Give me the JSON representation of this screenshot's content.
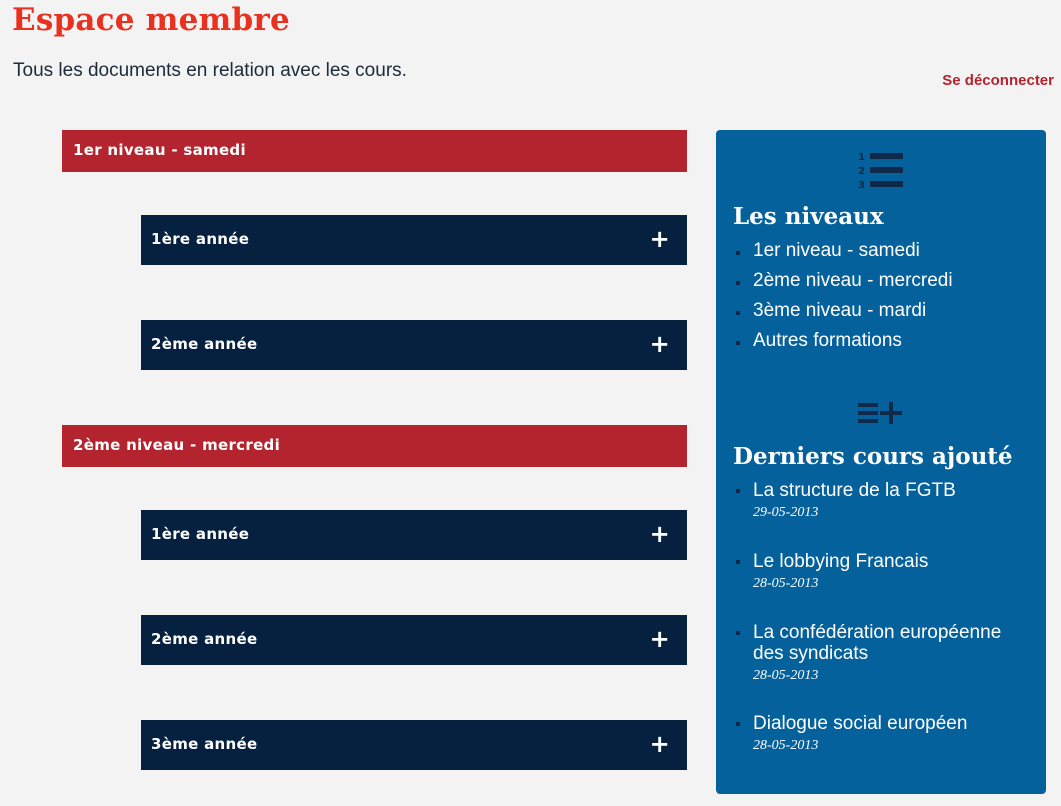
{
  "header": {
    "title": "Espace membre",
    "subtitle": "Tous les documents en relation avec les cours.",
    "logout": "Se déconnecter"
  },
  "levels": [
    {
      "label": "1er niveau - samedi",
      "years": [
        {
          "label": "1ère année",
          "toggle": "+"
        },
        {
          "label": "2ème année",
          "toggle": "+"
        }
      ]
    },
    {
      "label": "2ème niveau - mercredi",
      "years": [
        {
          "label": "1ère année",
          "toggle": "+"
        },
        {
          "label": "2ème année",
          "toggle": "+"
        },
        {
          "label": "3ème année",
          "toggle": "+"
        }
      ]
    }
  ],
  "sidebar": {
    "levels_icon": "numbered-list-icon",
    "levels_heading": "Les niveaux",
    "levels": [
      "1er niveau - samedi",
      "2ème niveau - mercredi",
      "3ème niveau - mardi",
      "Autres formations"
    ],
    "recent_icon": "list-add-icon",
    "recent_heading": "Derniers cours ajouté",
    "recent": [
      {
        "title": "La structure de la FGTB",
        "date": "29-05-2013"
      },
      {
        "title": "Le lobbying Francais",
        "date": "28-05-2013"
      },
      {
        "title": "La confédération européenne des syndicats",
        "date": "28-05-2013"
      },
      {
        "title": "Dialogue social européen",
        "date": "28-05-2013"
      }
    ]
  },
  "colors": {
    "title_red": "#e8321f",
    "level_bar": "#b3242e",
    "year_bar": "#06203f",
    "sidebar": "#04619c"
  }
}
